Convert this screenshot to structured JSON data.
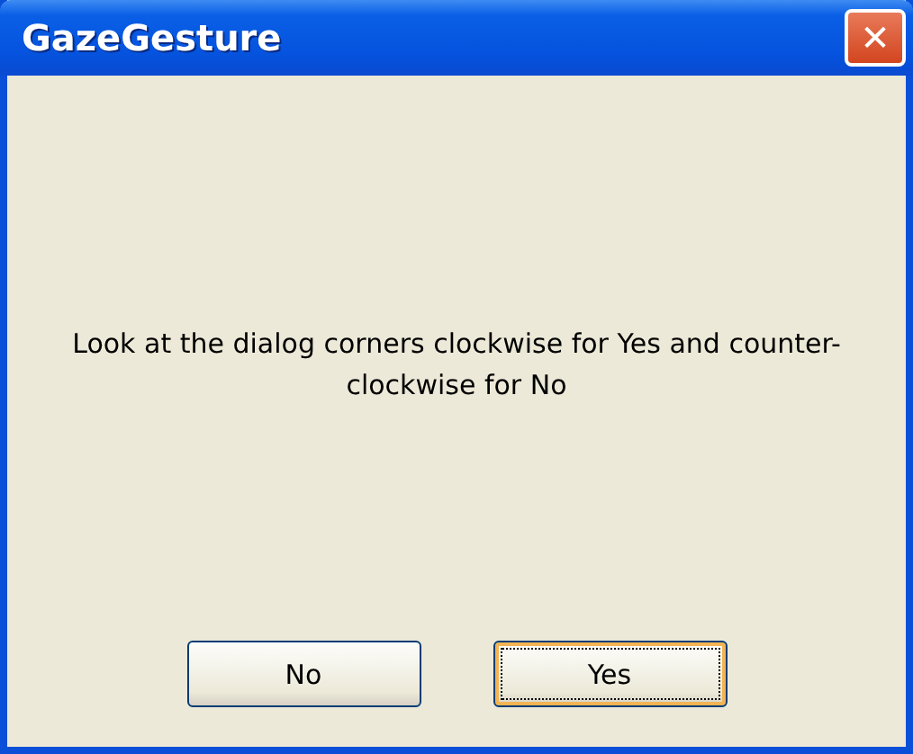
{
  "window": {
    "title": "GazeGesture",
    "close": "✕"
  },
  "message": "Look at the dialog corners clockwise for Yes and counter-clockwise for No",
  "buttons": [
    {
      "label": "No",
      "focused": false
    },
    {
      "label": "Yes",
      "focused": true
    }
  ]
}
